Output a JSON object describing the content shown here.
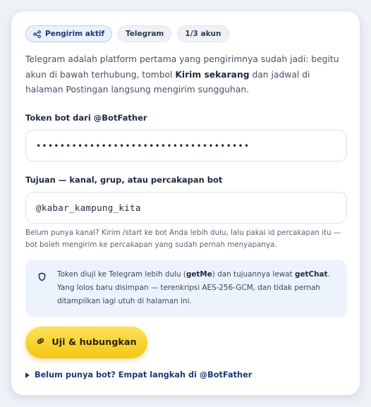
{
  "chips": [
    {
      "label": "Pengirim aktif",
      "icon": "share-icon"
    },
    {
      "label": "Telegram"
    },
    {
      "label": "1/3 akun"
    }
  ],
  "intro": {
    "part1": "Telegram adalah platform pertama yang pengirimnya sudah jadi: begitu akun di bawah terhubung, tombol ",
    "bold": "Kirim sekarang",
    "part2": " dan jadwal di halaman Postingan langsung mengirim sungguhan."
  },
  "token": {
    "label": "Token bot dari @BotFather",
    "value": "••••••••••••••••••••••••••••••••••••"
  },
  "target": {
    "label": "Tujuan — kanal, grup, atau percakapan bot",
    "value": "@kabar_kampung_kita"
  },
  "help": "Belum punya kanal? Kirim /start ke bot Anda lebih dulu, lalu pakai id percakapan itu — bot boleh mengirim ke percakapan yang sudah pernah menyapanya.",
  "note": {
    "icon": "shield-icon",
    "t1": "Token diuji ke Telegram lebih dulu (",
    "b1": "getMe",
    "t2": ") dan tujuannya lewat ",
    "b2": "getChat",
    "t3": ". Yang lolos baru disimpan — terenkripsi AES-256-GCM, dan tidak pernah ditampilkan lagi utuh di halaman ini."
  },
  "button": {
    "label": "Uji & hubungkan",
    "icon": "link-icon"
  },
  "details": {
    "label": "Belum punya bot? Empat langkah di @BotFather"
  },
  "colors": {
    "accent": "#f3c612",
    "link": "#1c3a75",
    "note_bg": "#edf3fc"
  }
}
